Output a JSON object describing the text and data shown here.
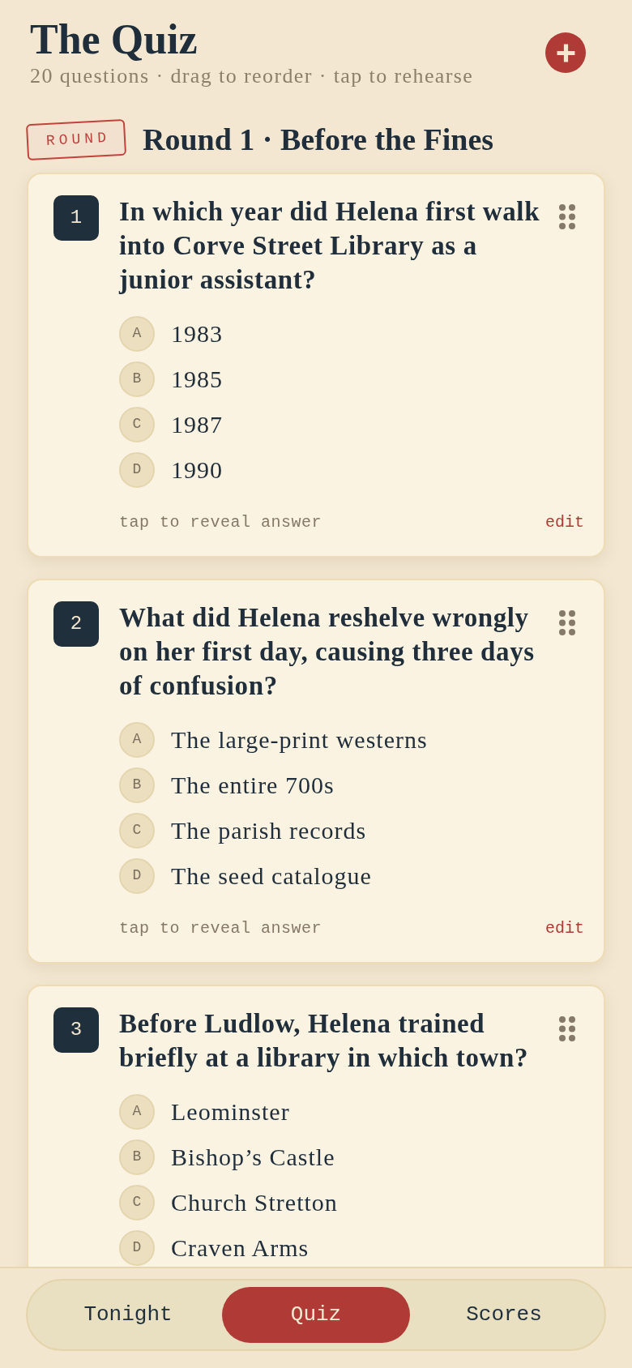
{
  "header": {
    "title": "The Quiz",
    "subtitle": "20 questions · drag to reorder · tap to rehearse"
  },
  "round": {
    "stamp": "ROUND",
    "title": "Round 1 · Before the Fines"
  },
  "questions": [
    {
      "number": "1",
      "text": "In which year did Helena first walk into Corve Street Library as a junior assistant?",
      "options": [
        {
          "letter": "A",
          "text": "1983"
        },
        {
          "letter": "B",
          "text": "1985"
        },
        {
          "letter": "C",
          "text": "1987"
        },
        {
          "letter": "D",
          "text": "1990"
        }
      ],
      "reveal_hint": "tap to reveal answer",
      "edit": "edit"
    },
    {
      "number": "2",
      "text": "What did Helena reshelve wrongly on her first day, causing three days of confusion?",
      "options": [
        {
          "letter": "A",
          "text": "The large-print westerns"
        },
        {
          "letter": "B",
          "text": "The entire 700s"
        },
        {
          "letter": "C",
          "text": "The parish records"
        },
        {
          "letter": "D",
          "text": "The seed catalogue"
        }
      ],
      "reveal_hint": "tap to reveal answer",
      "edit": "edit"
    },
    {
      "number": "3",
      "text": "Before Ludlow, Helena trained briefly at a library in which town?",
      "options": [
        {
          "letter": "A",
          "text": "Leominster"
        },
        {
          "letter": "B",
          "text": "Bishop’s Castle"
        },
        {
          "letter": "C",
          "text": "Church Stretton"
        },
        {
          "letter": "D",
          "text": "Craven Arms"
        }
      ]
    }
  ],
  "bottom_nav": {
    "tabs": [
      {
        "label": "Tonight",
        "selected": false
      },
      {
        "label": "Quiz",
        "selected": true
      },
      {
        "label": "Scores",
        "selected": false
      }
    ]
  }
}
